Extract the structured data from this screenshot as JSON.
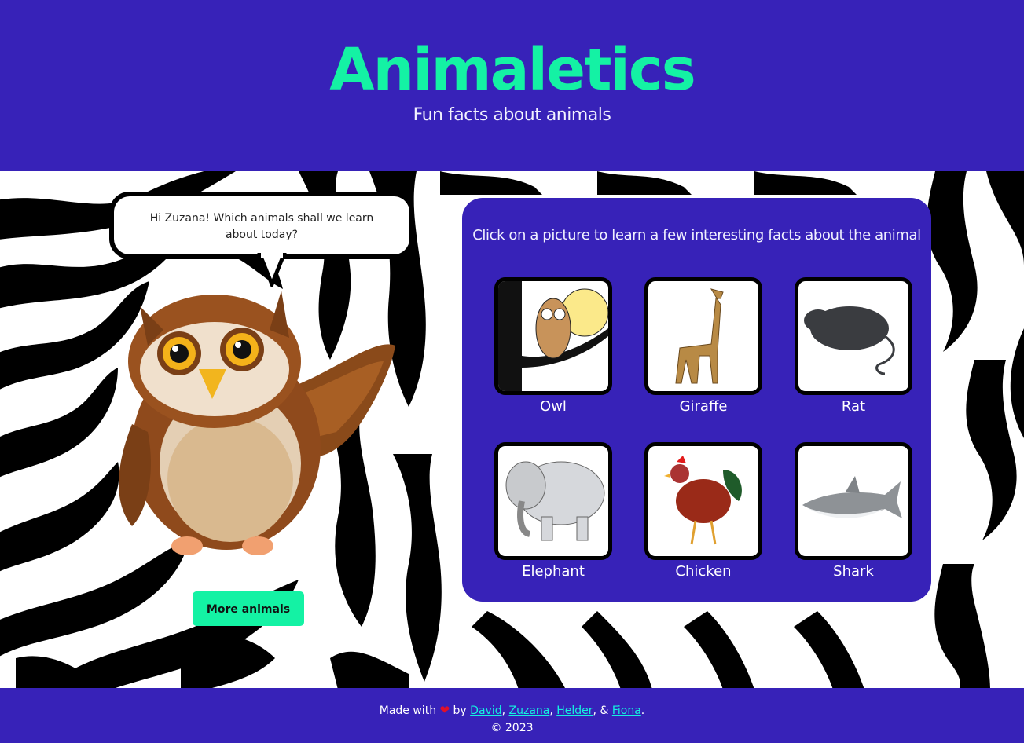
{
  "header": {
    "title": "Animaletics",
    "subtitle": "Fun facts about animals"
  },
  "owl_guide": {
    "speech": "Hi Zuzana! Which animals shall we learn about today?",
    "more_button_label": "More animals"
  },
  "panel": {
    "prompt": "Click on a picture to learn a few interesting facts about the animal",
    "animals": [
      {
        "name": "Owl",
        "icon": "owl-icon"
      },
      {
        "name": "Giraffe",
        "icon": "giraffe-icon"
      },
      {
        "name": "Rat",
        "icon": "rat-icon"
      },
      {
        "name": "Elephant",
        "icon": "elephant-icon"
      },
      {
        "name": "Chicken",
        "icon": "chicken-icon"
      },
      {
        "name": "Shark",
        "icon": "shark-icon"
      }
    ]
  },
  "footer": {
    "made_with": "Made with",
    "heart": "❤",
    "by": "by",
    "authors": [
      "David",
      "Zuzana",
      "Helder",
      "Fiona"
    ],
    "sep1": ",",
    "sep2": ",",
    "sep3": ", &",
    "end": ".",
    "copyright": "© 2023"
  },
  "colors": {
    "brand_bg": "#3722b8",
    "accent": "#14f2a4",
    "link": "#14f2e0"
  }
}
